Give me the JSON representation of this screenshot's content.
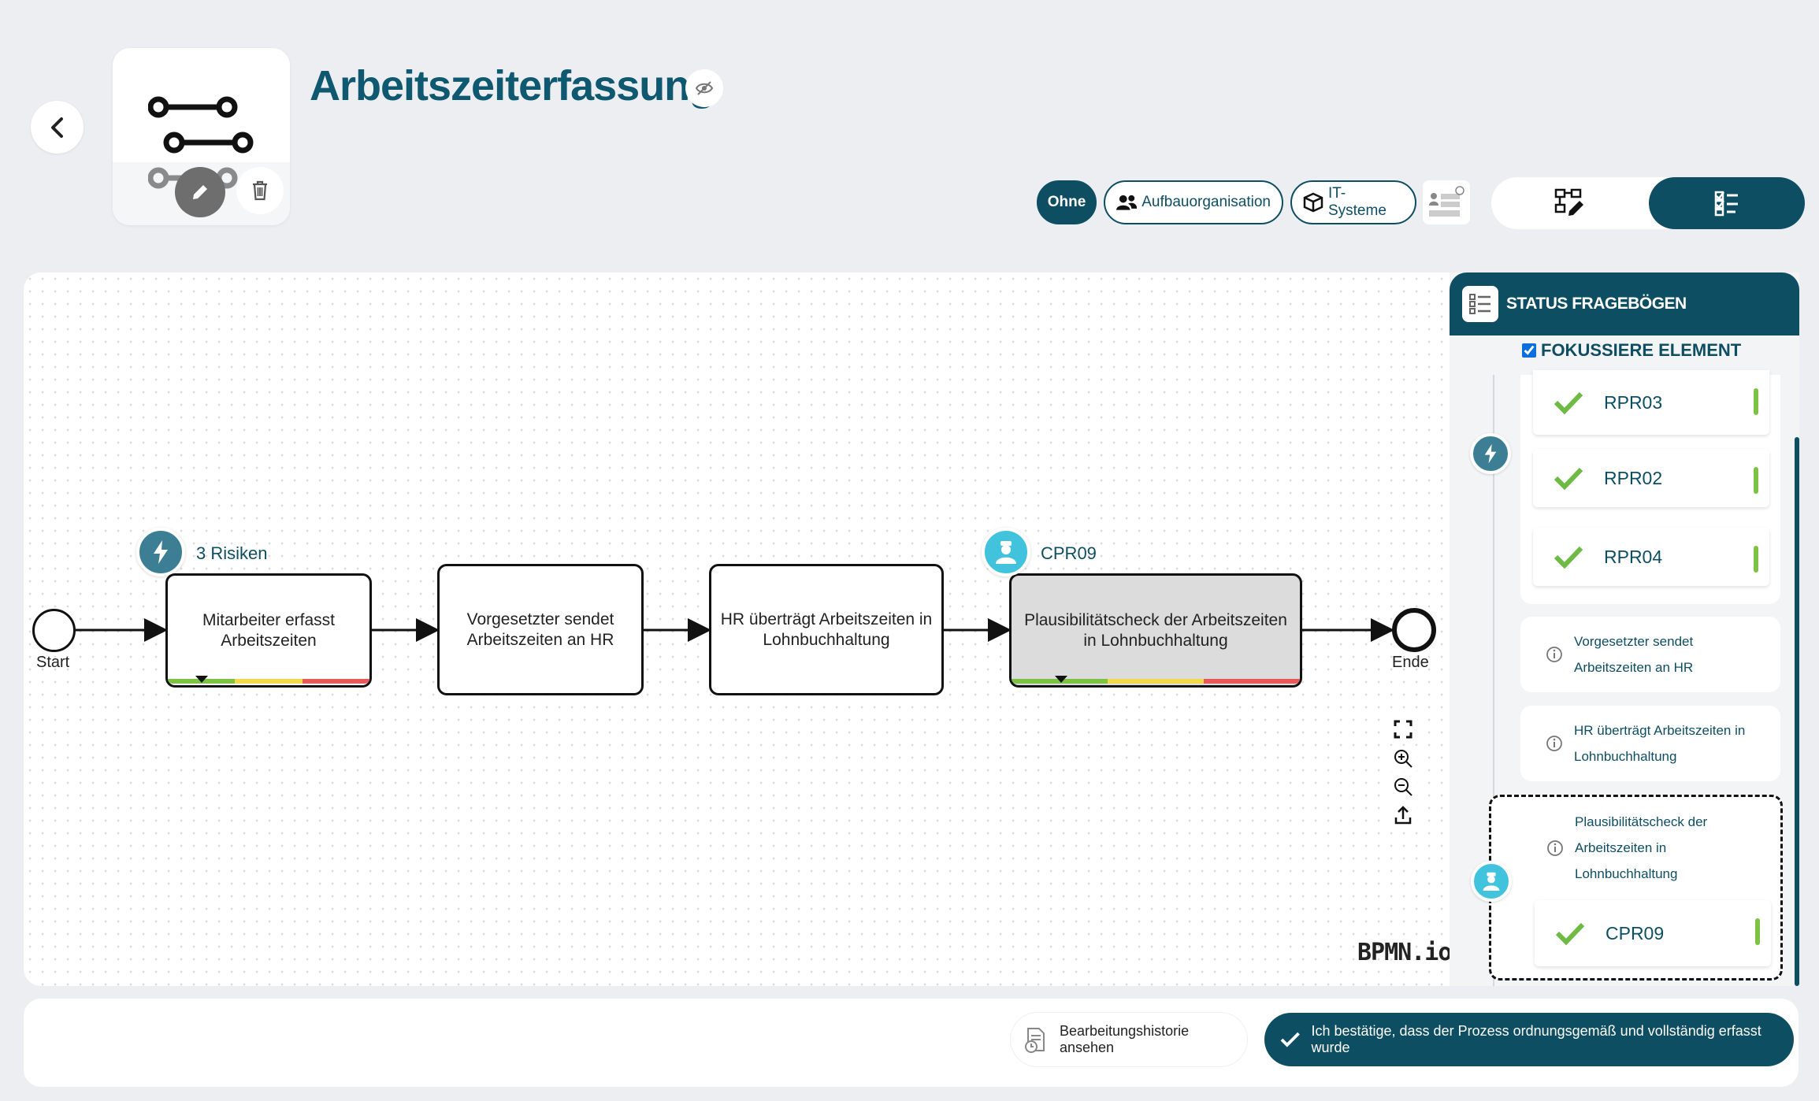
{
  "header": {
    "title": "Arbeitszeiterfassung",
    "filters": {
      "ohne": "Ohne",
      "aufbauorganisation": "Aufbauorganisation",
      "it_systeme": "IT-Systeme"
    }
  },
  "diagram": {
    "start_label": "Start",
    "end_label": "Ende",
    "tasks": [
      "Mitarbeiter erfasst Arbeitszeiten",
      "Vorgesetzter sendet Arbeitszeiten an HR",
      "HR überträgt Arbeitszeiten in Lohnbuchhaltung",
      "Plausibilitätscheck der Arbeitszeiten in Lohnbuchhaltung"
    ],
    "risk_badge_label": "3 Risiken",
    "control_badge_label": "CPR09",
    "watermark": "BPMN.io",
    "status_bar_colors": [
      "#7cc243",
      "#f2d94a",
      "#e85a5a"
    ]
  },
  "panel": {
    "title": "STATUS FRAGEBÖGEN",
    "focus_label": "FOKUSSIERE ELEMENT",
    "focus_checked": true,
    "risk_questionnaires": [
      "RPR03",
      "RPR02",
      "RPR04"
    ],
    "task_items": [
      "Vorgesetzter sendet Arbeitszeiten an HR",
      "HR überträgt Arbeitszeiten in Lohnbuchhaltung"
    ],
    "focused_item": "Plausibilitätscheck der Arbeitszeiten in Lohnbuchhaltung",
    "control_questionnaires": [
      "CPR09"
    ],
    "status_color": "#7cc243"
  },
  "footer": {
    "history_label": "Bearbeitungshistorie ansehen",
    "confirm_label": "Ich bestätige, dass der Prozess ordnungsgemäß und vollständig erfasst wurde"
  },
  "colors": {
    "primary": "#0e4e63",
    "risk_badge": "#3c7f95",
    "control_badge": "#41c3de",
    "success": "#7cc243"
  }
}
